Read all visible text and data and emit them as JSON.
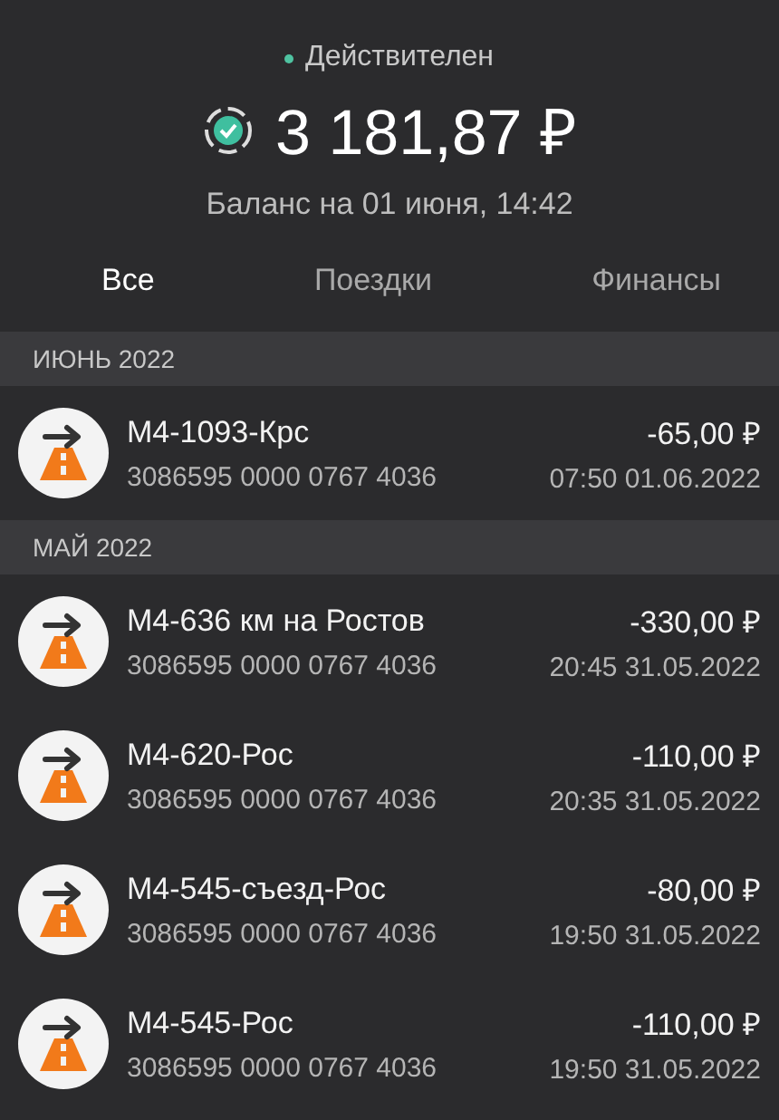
{
  "account": {
    "status": "Действителен",
    "balance": "3 181,87 ₽",
    "balance_date": "Баланс на 01 июня, 14:42"
  },
  "tabs": [
    {
      "label": "Все",
      "selected": true
    },
    {
      "label": "Поездки",
      "selected": false
    },
    {
      "label": "Финансы",
      "selected": false
    }
  ],
  "sections": [
    {
      "title": "ИЮНЬ 2022",
      "items": [
        {
          "name": "М4-1093-Крс",
          "card": "3086595 0000 0767 4036",
          "amount": "-65,00 ₽",
          "time": "07:50 01.06.2022"
        }
      ]
    },
    {
      "title": "МАЙ 2022",
      "items": [
        {
          "name": "М4-636 км на Ростов",
          "card": "3086595 0000 0767 4036",
          "amount": "-330,00 ₽",
          "time": "20:45 31.05.2022"
        },
        {
          "name": "М4-620-Рос",
          "card": "3086595 0000 0767 4036",
          "amount": "-110,00 ₽",
          "time": "20:35 31.05.2022"
        },
        {
          "name": "М4-545-съезд-Рос",
          "card": "3086595 0000 0767 4036",
          "amount": "-80,00 ₽",
          "time": "19:50 31.05.2022"
        },
        {
          "name": "М4-545-Рос",
          "card": "3086595 0000 0767 4036",
          "amount": "-110,00 ₽",
          "time": "19:50 31.05.2022"
        }
      ]
    }
  ]
}
